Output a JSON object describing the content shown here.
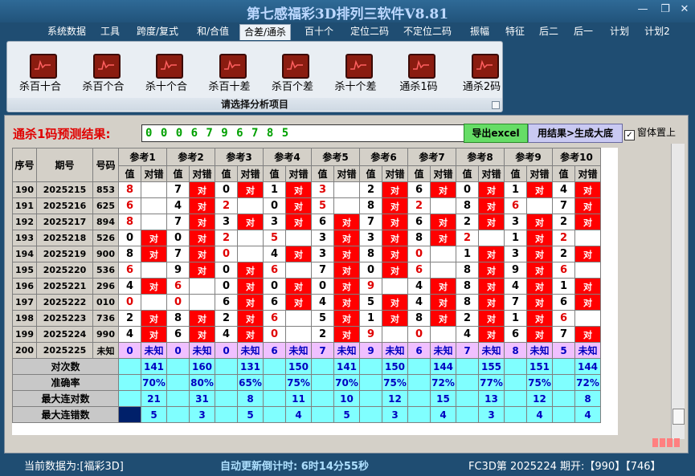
{
  "window": {
    "title": "第七感福彩3D排列三软件V8.81",
    "minimize_icon": "minimize-icon",
    "restore_icon": "restore-icon",
    "close_icon": "close-icon"
  },
  "menu": [
    {
      "label": "系统数据",
      "active": false
    },
    {
      "label": "工具",
      "active": false
    },
    {
      "label": "跨度/复式",
      "active": false
    },
    {
      "label": "和/合值",
      "active": false
    },
    {
      "label": "合差/通杀",
      "active": true
    },
    {
      "label": "百十个",
      "active": false
    },
    {
      "label": "定位二码",
      "active": false
    },
    {
      "label": "不定位二码",
      "active": false
    },
    {
      "label": "振幅",
      "active": false
    },
    {
      "label": "特征",
      "active": false
    },
    {
      "label": "后二",
      "active": false
    },
    {
      "label": "后一",
      "active": false
    },
    {
      "label": "计划",
      "active": false
    },
    {
      "label": "计划2",
      "active": false
    }
  ],
  "ribbon": {
    "buttons": [
      "杀百十合",
      "杀百个合",
      "杀十个合",
      "杀百十差",
      "杀百个差",
      "杀十个差",
      "通杀1码",
      "通杀2码"
    ],
    "caption": "请选择分析项目"
  },
  "prediction": {
    "label": "通杀1码预测结果:",
    "value": "0 0 0 6 7 9 6 7 8 5",
    "export_label": "导出excel",
    "generate_label": "用结果>生成大底",
    "on_top_label": "窗体置上",
    "on_top_checked": true
  },
  "table": {
    "col_headers": {
      "seq": "序号",
      "period": "期号",
      "number": "号码"
    },
    "ref_labels": [
      "参考1",
      "参考2",
      "参考3",
      "参考4",
      "参考5",
      "参考6",
      "参考7",
      "参考8",
      "参考9",
      "参考10"
    ],
    "sub_labels": {
      "value": "值",
      "result": "对错"
    },
    "hit_text": "对",
    "unknown_text": "未知",
    "rows": [
      {
        "seq": "190",
        "period": "2025215",
        "number": "853",
        "refs": [
          [
            "8",
            "",
            true
          ],
          [
            "7",
            "对",
            false
          ],
          [
            "0",
            "对",
            false
          ],
          [
            "1",
            "对",
            false
          ],
          [
            "3",
            "",
            true
          ],
          [
            "2",
            "对",
            false
          ],
          [
            "6",
            "对",
            false
          ],
          [
            "0",
            "对",
            false
          ],
          [
            "1",
            "对",
            false
          ],
          [
            "4",
            "对",
            false
          ]
        ]
      },
      {
        "seq": "191",
        "period": "2025216",
        "number": "625",
        "refs": [
          [
            "6",
            "",
            true
          ],
          [
            "4",
            "对",
            false
          ],
          [
            "2",
            "",
            true
          ],
          [
            "0",
            "对",
            false
          ],
          [
            "5",
            "",
            true
          ],
          [
            "8",
            "对",
            false
          ],
          [
            "2",
            "",
            true
          ],
          [
            "8",
            "对",
            false
          ],
          [
            "6",
            "",
            true
          ],
          [
            "7",
            "对",
            false
          ]
        ]
      },
      {
        "seq": "192",
        "period": "2025217",
        "number": "894",
        "refs": [
          [
            "8",
            "",
            true
          ],
          [
            "7",
            "对",
            false
          ],
          [
            "3",
            "对",
            false
          ],
          [
            "3",
            "对",
            false
          ],
          [
            "6",
            "对",
            false
          ],
          [
            "7",
            "对",
            false
          ],
          [
            "6",
            "对",
            false
          ],
          [
            "2",
            "对",
            false
          ],
          [
            "3",
            "对",
            false
          ],
          [
            "2",
            "对",
            false
          ]
        ]
      },
      {
        "seq": "193",
        "period": "2025218",
        "number": "526",
        "refs": [
          [
            "0",
            "对",
            false
          ],
          [
            "0",
            "对",
            false
          ],
          [
            "2",
            "",
            true
          ],
          [
            "5",
            "",
            true
          ],
          [
            "3",
            "对",
            false
          ],
          [
            "3",
            "对",
            false
          ],
          [
            "8",
            "对",
            false
          ],
          [
            "2",
            "",
            true
          ],
          [
            "1",
            "对",
            false
          ],
          [
            "2",
            "",
            true
          ]
        ]
      },
      {
        "seq": "194",
        "period": "2025219",
        "number": "900",
        "refs": [
          [
            "8",
            "对",
            false
          ],
          [
            "7",
            "对",
            false
          ],
          [
            "0",
            "",
            true
          ],
          [
            "4",
            "对",
            false
          ],
          [
            "3",
            "对",
            false
          ],
          [
            "8",
            "对",
            false
          ],
          [
            "0",
            "",
            true
          ],
          [
            "1",
            "对",
            false
          ],
          [
            "3",
            "对",
            false
          ],
          [
            "2",
            "对",
            false
          ]
        ]
      },
      {
        "seq": "195",
        "period": "2025220",
        "number": "536",
        "refs": [
          [
            "6",
            "",
            true
          ],
          [
            "9",
            "对",
            false
          ],
          [
            "0",
            "对",
            false
          ],
          [
            "6",
            "",
            true
          ],
          [
            "7",
            "对",
            false
          ],
          [
            "0",
            "对",
            false
          ],
          [
            "6",
            "",
            true
          ],
          [
            "8",
            "对",
            false
          ],
          [
            "9",
            "对",
            false
          ],
          [
            "6",
            "",
            true
          ]
        ]
      },
      {
        "seq": "196",
        "period": "2025221",
        "number": "296",
        "refs": [
          [
            "4",
            "对",
            false
          ],
          [
            "6",
            "",
            true
          ],
          [
            "0",
            "对",
            false
          ],
          [
            "0",
            "对",
            false
          ],
          [
            "0",
            "对",
            false
          ],
          [
            "9",
            "",
            true
          ],
          [
            "4",
            "对",
            false
          ],
          [
            "8",
            "对",
            false
          ],
          [
            "4",
            "对",
            false
          ],
          [
            "1",
            "对",
            false
          ]
        ]
      },
      {
        "seq": "197",
        "period": "2025222",
        "number": "010",
        "refs": [
          [
            "0",
            "",
            true
          ],
          [
            "0",
            "",
            true
          ],
          [
            "6",
            "对",
            false
          ],
          [
            "6",
            "对",
            false
          ],
          [
            "4",
            "对",
            false
          ],
          [
            "5",
            "对",
            false
          ],
          [
            "4",
            "对",
            false
          ],
          [
            "8",
            "对",
            false
          ],
          [
            "7",
            "对",
            false
          ],
          [
            "6",
            "对",
            false
          ]
        ]
      },
      {
        "seq": "198",
        "period": "2025223",
        "number": "736",
        "refs": [
          [
            "2",
            "对",
            false
          ],
          [
            "8",
            "对",
            false
          ],
          [
            "2",
            "对",
            false
          ],
          [
            "6",
            "",
            true
          ],
          [
            "5",
            "对",
            false
          ],
          [
            "1",
            "对",
            false
          ],
          [
            "8",
            "对",
            false
          ],
          [
            "2",
            "对",
            false
          ],
          [
            "1",
            "对",
            false
          ],
          [
            "6",
            "",
            true
          ]
        ]
      },
      {
        "seq": "199",
        "period": "2025224",
        "number": "990",
        "refs": [
          [
            "4",
            "对",
            false
          ],
          [
            "6",
            "对",
            false
          ],
          [
            "4",
            "对",
            false
          ],
          [
            "0",
            "",
            true
          ],
          [
            "2",
            "对",
            false
          ],
          [
            "9",
            "",
            true
          ],
          [
            "0",
            "",
            true
          ],
          [
            "4",
            "对",
            false
          ],
          [
            "6",
            "对",
            false
          ],
          [
            "7",
            "对",
            false
          ]
        ]
      }
    ],
    "last_row": {
      "seq": "200",
      "period": "2025225",
      "number": "未知",
      "values": [
        "0",
        "0",
        "0",
        "6",
        "7",
        "9",
        "6",
        "7",
        "8",
        "5"
      ]
    },
    "stats": [
      {
        "label": "对次数",
        "values": [
          "141",
          "160",
          "131",
          "150",
          "141",
          "150",
          "144",
          "155",
          "151",
          "144"
        ]
      },
      {
        "label": "准确率",
        "values": [
          "70%",
          "80%",
          "65%",
          "75%",
          "70%",
          "75%",
          "72%",
          "77%",
          "75%",
          "72%"
        ]
      },
      {
        "label": "最大连对数",
        "values": [
          "21",
          "31",
          "8",
          "11",
          "10",
          "12",
          "15",
          "13",
          "12",
          "8"
        ]
      },
      {
        "label": "最大连错数",
        "values": [
          "5",
          "3",
          "5",
          "4",
          "5",
          "3",
          "4",
          "3",
          "4",
          "4"
        ]
      }
    ]
  },
  "status": {
    "current_data": "当前数据为:[福彩3D]",
    "countdown": "自动更新倒计时: 6时14分55秒",
    "draw_info": "FC3D第 2025224 期开:【990】【746】"
  }
}
